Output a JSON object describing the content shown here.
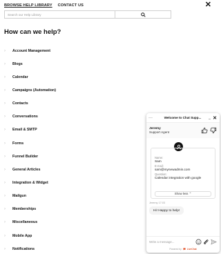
{
  "nav": {
    "tabs": [
      {
        "label": "BROWSE HELP LIBRARY",
        "active": true
      },
      {
        "label": "CONTACT US",
        "active": false
      }
    ],
    "close_glyph": "✕"
  },
  "search": {
    "placeholder": "Search our Help Library",
    "icon": "search-icon"
  },
  "main": {
    "heading": "How can we help?",
    "categories": [
      "Account Management",
      "Blogs",
      "Calendar",
      "Campaigns (Automation)",
      "Contacts",
      "Conversations",
      "Email & SMTP",
      "Forms",
      "Funnel Builder",
      "General Articles",
      "Integration & Widget",
      "Mailgun",
      "Memberships",
      "Miscellaneous",
      "Mobile App",
      "Notifications"
    ],
    "chevron": "›"
  },
  "chat": {
    "title": "Welcome to Chat Supp...",
    "menu_glyph": "···",
    "minimize_glyph": "_",
    "close_glyph": "✕",
    "agent_name": "Jeremy",
    "agent_role": "Support Agent",
    "form": {
      "name_label": "Name:",
      "name_value": "Sam",
      "email_label": "E-mail:",
      "email_value": "sam@mynewadmin.com",
      "question_label": "Question:",
      "question_value": "Calendar integration with google",
      "show_less": "Show less ⌃"
    },
    "message_meta": "Jeremy 17:03",
    "message_text": "Hi! Happy to help!",
    "composer_placeholder": "Write a message...",
    "powered_prefix": "Powered by",
    "powered_brand": "LiveChat",
    "colors": {
      "brand": "#e2552d",
      "avatar": "#111111"
    }
  }
}
